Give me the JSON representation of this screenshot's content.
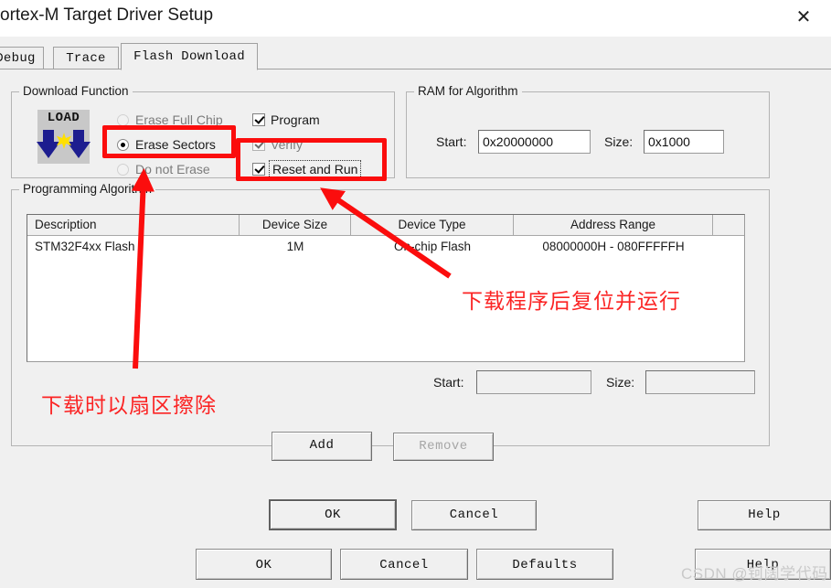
{
  "background_window": {
    "buttons": [
      {
        "label": "OK",
        "id": "bg-btn-ok"
      },
      {
        "label": "Cancel",
        "id": "bg-btn-cancel"
      },
      {
        "label": "Defaults",
        "id": "bg-btn-def"
      },
      {
        "label": "Help",
        "id": "bg-btn-help"
      }
    ],
    "watermark": "CSDN @钶阔学代码"
  },
  "dialog": {
    "title": "ortex-M Target Driver Setup",
    "close_icon": "✕",
    "tabs": [
      {
        "label": "Debug",
        "active": false
      },
      {
        "label": "Trace",
        "active": false
      },
      {
        "label": "Flash Download",
        "active": true
      }
    ],
    "download_function": {
      "legend": "Download Function",
      "icon_text": "LOAD",
      "radios": [
        {
          "label": "Erase Full Chip",
          "checked": false
        },
        {
          "label": "Erase Sectors",
          "checked": true
        },
        {
          "label": "Do not Erase",
          "checked": false
        }
      ],
      "checkboxes": [
        {
          "label": "Program",
          "checked": true,
          "focused": false
        },
        {
          "label": "Verify",
          "checked": true,
          "focused": false
        },
        {
          "label": "Reset and Run",
          "checked": true,
          "focused": true
        }
      ]
    },
    "ram_for_algorithm": {
      "legend": "RAM for Algorithm",
      "start_label": "Start:",
      "start_value": "0x20000000",
      "size_label": "Size:",
      "size_value": "0x1000"
    },
    "programming_algorithm": {
      "legend": "Programming Algorithm",
      "columns": [
        "Description",
        "Device Size",
        "Device Type",
        "Address Range",
        ""
      ],
      "rows": [
        {
          "description": "STM32F4xx Flash",
          "device_size": "1M",
          "device_type": "On-chip Flash",
          "address_range": "08000000H - 080FFFFFH"
        }
      ],
      "start_label": "Start:",
      "start_value": "",
      "size_label": "Size:",
      "size_value": "",
      "add_label": "Add",
      "remove_label": "Remove",
      "remove_disabled": true
    },
    "footer_buttons": {
      "ok": "OK",
      "cancel": "Cancel",
      "help": "Help"
    }
  },
  "annotations": {
    "accent_color": "#fb0d0d",
    "text_color": "#fb2424",
    "reset_note": "下载程序后复位并运行",
    "erase_note": "下载时以扇区擦除"
  }
}
